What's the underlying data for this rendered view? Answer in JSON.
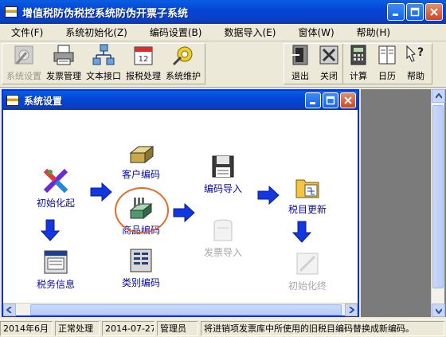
{
  "window": {
    "title": "增值税防伪税控系统防伪开票子系统"
  },
  "menu": [
    {
      "label": "文件(F)"
    },
    {
      "label": "系统初始化(Z)"
    },
    {
      "label": "编码设置(B)"
    },
    {
      "label": "数据导入(E)"
    },
    {
      "label": "窗体(W)"
    },
    {
      "label": "帮助(H)"
    }
  ],
  "toolbar": {
    "left": [
      {
        "label": "系统设置",
        "icon": "wrench-disk-icon",
        "enabled": false
      },
      {
        "label": "发票管理",
        "icon": "printer-icon",
        "enabled": true
      },
      {
        "label": "文本接口",
        "icon": "network-icon",
        "enabled": true
      },
      {
        "label": "报税处理",
        "icon": "calendar-icon",
        "enabled": true
      },
      {
        "label": "系统维护",
        "icon": "key-gear-icon",
        "enabled": true
      }
    ],
    "right": [
      {
        "label": "退出",
        "icon": "exit-door-icon"
      },
      {
        "label": "关闭",
        "icon": "close-tools-icon"
      },
      {
        "label": "计算",
        "icon": "calculator-icon"
      },
      {
        "label": "日历",
        "icon": "calendar-book-icon"
      },
      {
        "label": "帮助",
        "icon": "help-icon"
      }
    ]
  },
  "child": {
    "title": "系统设置",
    "nodes": {
      "init_start": "初始化起",
      "customer_code": "客户编码",
      "product_code": "商品编码",
      "code_import": "编码导入",
      "tax_update": "税目更新",
      "tax_info": "税务信息",
      "category_code": "类别编码",
      "invoice_import": "发票导入",
      "init_end": "初始化终"
    }
  },
  "status": {
    "period": "2014年6月",
    "mode": "正常处理",
    "date": "2014-07-27",
    "user": "管理员",
    "message": "将进销项发票库中所使用的旧税目编码替换成新编码。"
  }
}
